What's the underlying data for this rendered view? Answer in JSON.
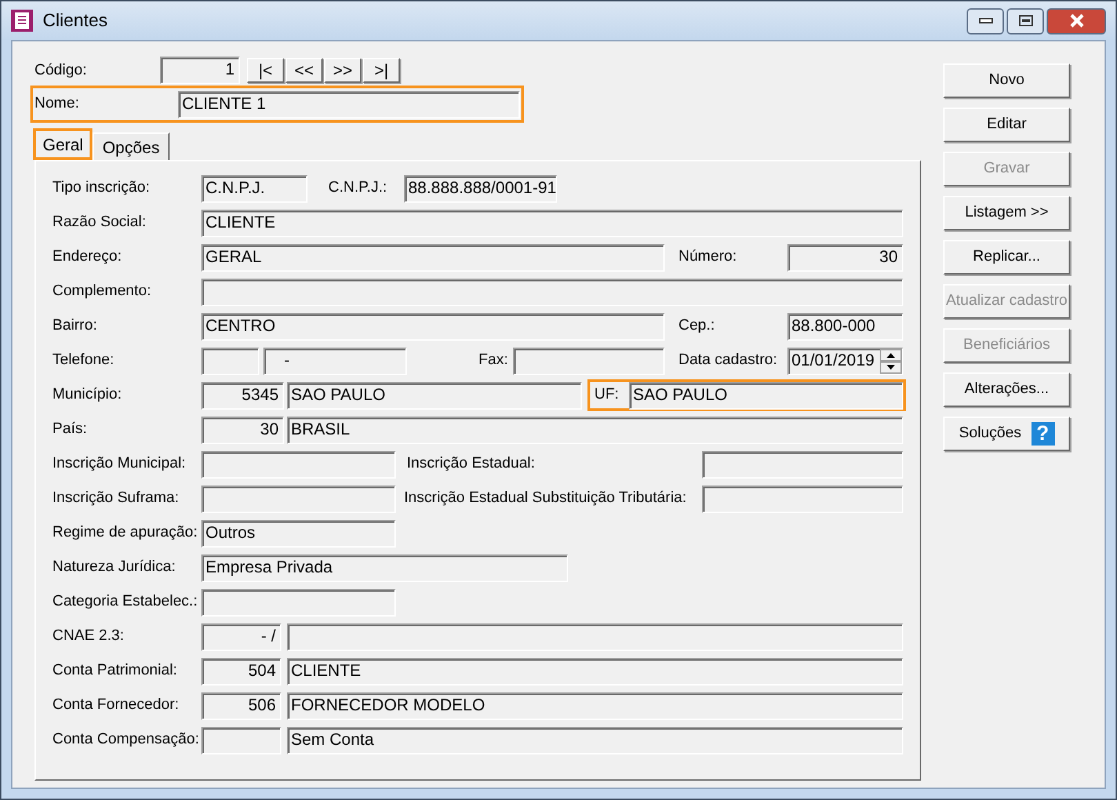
{
  "window": {
    "title": "Clientes"
  },
  "header": {
    "codigo": {
      "label": "Código:",
      "value": "1"
    },
    "nav_buttons": [
      "|<",
      "<<",
      ">>",
      ">|"
    ],
    "nome": {
      "label": "Nome:",
      "value": "CLIENTE 1",
      "highlighted": true
    }
  },
  "tabs": [
    {
      "label": "Geral",
      "selected": true,
      "highlighted": true
    },
    {
      "label": "Opções",
      "selected": false,
      "highlighted": false
    }
  ],
  "form_rows": [
    {
      "items": [
        {
          "kind": "label",
          "text": "Tipo inscrição:"
        },
        {
          "kind": "text",
          "value": "C.N.P.J."
        },
        {
          "kind": "label",
          "text": "C.N.P.J.:"
        },
        {
          "kind": "text",
          "value": "88.888.888/0001-91"
        }
      ]
    },
    {
      "items": [
        {
          "kind": "label",
          "text": "Razão Social:"
        },
        {
          "kind": "text",
          "value": "CLIENTE"
        }
      ]
    },
    {
      "items": [
        {
          "kind": "label",
          "text": "Endereço:"
        },
        {
          "kind": "text",
          "value": "GERAL"
        },
        {
          "kind": "label",
          "text": "Número:"
        },
        {
          "kind": "number",
          "value": "30"
        }
      ]
    },
    {
      "items": [
        {
          "kind": "label",
          "text": "Complemento:"
        },
        {
          "kind": "text"
        }
      ]
    },
    {
      "items": [
        {
          "kind": "label",
          "text": "Bairro:"
        },
        {
          "kind": "text",
          "value": "CENTRO"
        },
        {
          "kind": "label",
          "text": "Cep.:"
        },
        {
          "kind": "text",
          "value": "88.800-000"
        }
      ]
    },
    {
      "items": [
        {
          "kind": "label",
          "text": "Telefone:"
        },
        {
          "kind": "text"
        },
        {
          "kind": "masked",
          "value": "-"
        },
        {
          "kind": "label",
          "text": "Fax:"
        },
        {
          "kind": "text"
        },
        {
          "kind": "label",
          "text": "Data cadastro:"
        },
        {
          "kind": "date",
          "value": "01/01/2019"
        }
      ]
    },
    {
      "items": [
        {
          "kind": "label",
          "text": "Município:"
        },
        {
          "kind": "number",
          "value": "5345"
        },
        {
          "kind": "text",
          "value": "SAO PAULO"
        },
        {
          "kind": "group",
          "highlighted": true,
          "items": [
            {
              "kind": "label",
              "text": "UF:"
            },
            {
              "kind": "text",
              "value": "SAO PAULO"
            }
          ]
        }
      ]
    },
    {
      "items": [
        {
          "kind": "label",
          "text": "País:"
        },
        {
          "kind": "number",
          "value": "30"
        },
        {
          "kind": "text",
          "value": "BRASIL"
        }
      ]
    },
    {
      "items": [
        {
          "kind": "label",
          "text": "Inscrição Municipal:"
        },
        {
          "kind": "text"
        },
        {
          "kind": "label",
          "text": "Inscrição Estadual:"
        },
        {
          "kind": "text"
        }
      ]
    },
    {
      "items": [
        {
          "kind": "label",
          "text": "Inscrição Suframa:"
        },
        {
          "kind": "text"
        },
        {
          "kind": "label",
          "text": "Inscrição Estadual Substituição Tributária:"
        },
        {
          "kind": "text"
        }
      ]
    },
    {
      "items": [
        {
          "kind": "label",
          "text": "Regime de apuração:"
        },
        {
          "kind": "text",
          "value": "Outros"
        }
      ]
    },
    {
      "items": [
        {
          "kind": "label",
          "text": "Natureza Jurídica:"
        },
        {
          "kind": "text",
          "value": "Empresa Privada"
        }
      ]
    },
    {
      "items": [
        {
          "kind": "label",
          "text": "Categoria Estabelec.:"
        },
        {
          "kind": "text"
        }
      ]
    },
    {
      "items": [
        {
          "kind": "label",
          "text": "CNAE 2.3:"
        },
        {
          "kind": "number",
          "value": "- /"
        },
        {
          "kind": "text"
        }
      ]
    },
    {
      "items": [
        {
          "kind": "label",
          "text": "Conta Patrimonial:"
        },
        {
          "kind": "number",
          "value": "504"
        },
        {
          "kind": "text",
          "value": "CLIENTE"
        }
      ]
    },
    {
      "items": [
        {
          "kind": "label",
          "text": "Conta Fornecedor:"
        },
        {
          "kind": "number",
          "value": "506"
        },
        {
          "kind": "text",
          "value": "FORNECEDOR MODELO"
        }
      ]
    },
    {
      "items": [
        {
          "kind": "label",
          "text": "Conta Compensação:"
        },
        {
          "kind": "number"
        },
        {
          "kind": "text",
          "value": "Sem Conta"
        }
      ]
    }
  ],
  "buttons": [
    {
      "label": "Novo",
      "disabled": false
    },
    {
      "label": "Editar",
      "disabled": false
    },
    {
      "label": "Gravar",
      "disabled": true
    },
    {
      "label": "Listagem >>",
      "disabled": false
    },
    {
      "label": "Replicar...",
      "disabled": false
    },
    {
      "label": "Atualizar cadastro",
      "disabled": true
    },
    {
      "label": "Beneficiários",
      "disabled": true
    },
    {
      "label": "Alterações...",
      "disabled": false
    },
    {
      "label": "Soluções",
      "disabled": false,
      "help_mark": "?"
    }
  ]
}
